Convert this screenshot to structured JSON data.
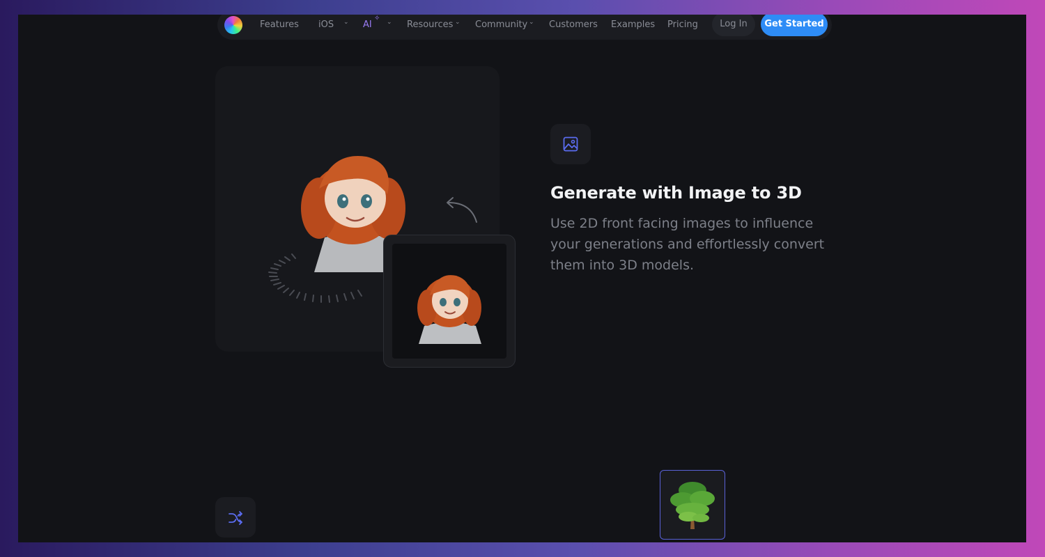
{
  "nav": {
    "items": [
      {
        "label": "Features"
      },
      {
        "label": "iOS"
      },
      {
        "label": "AI"
      },
      {
        "label": "Resources"
      },
      {
        "label": "Community"
      },
      {
        "label": "Customers"
      },
      {
        "label": "Examples"
      },
      {
        "label": "Pricing"
      }
    ],
    "login_label": "Log In",
    "cta_label": "Get Started"
  },
  "feature": {
    "title": "Generate with Image to 3D",
    "description": "Use 2D front facing images to influence your generations and effortlessly convert them into 3D models."
  },
  "colors": {
    "accent": "#2e8cf6",
    "icon_accent": "#5b6cf0",
    "background": "#121317"
  },
  "icons": {
    "feature_icon": "image-icon",
    "shuffle_icon": "shuffle-icon"
  }
}
